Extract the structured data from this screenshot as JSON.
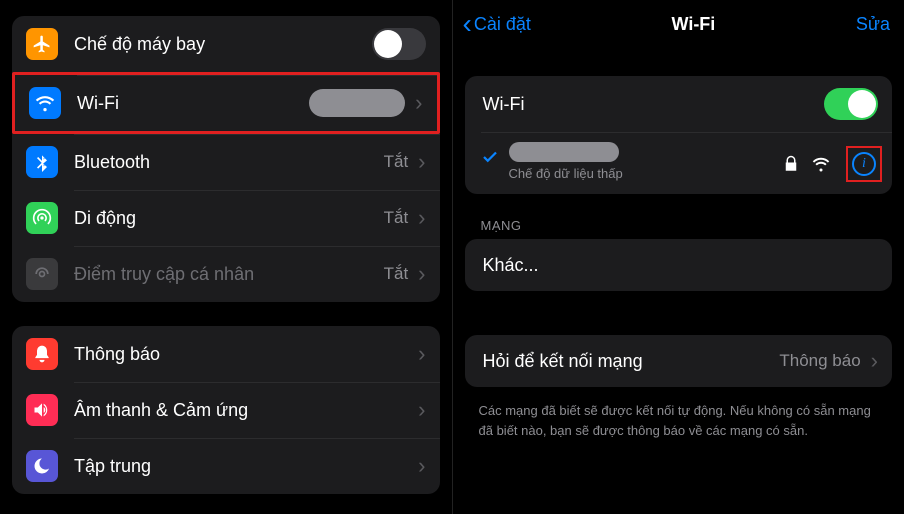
{
  "left": {
    "rows": [
      {
        "label": "Chế độ máy bay",
        "toggle": "off"
      },
      {
        "label": "Wi-Fi",
        "value": ""
      },
      {
        "label": "Bluetooth",
        "value": "Tắt"
      },
      {
        "label": "Di động",
        "value": "Tắt"
      },
      {
        "label": "Điểm truy cập cá nhân",
        "value": "Tắt"
      }
    ],
    "group2": [
      {
        "label": "Thông báo"
      },
      {
        "label": "Âm thanh & Cảm ứng"
      },
      {
        "label": "Tập trung"
      }
    ]
  },
  "right": {
    "back": "Cài đặt",
    "title": "Wi-Fi",
    "edit": "Sửa",
    "wifi_label": "Wi-Fi",
    "connected_sub": "Chế độ dữ liệu thấp",
    "networks_header": "MẠNG",
    "other": "Khác...",
    "ask_label": "Hỏi để kết nối mạng",
    "ask_value": "Thông báo",
    "footer": "Các mạng đã biết sẽ được kết nối tự động. Nếu không có sẵn mạng đã biết nào, bạn sẽ được thông báo về các mạng có sẵn."
  }
}
